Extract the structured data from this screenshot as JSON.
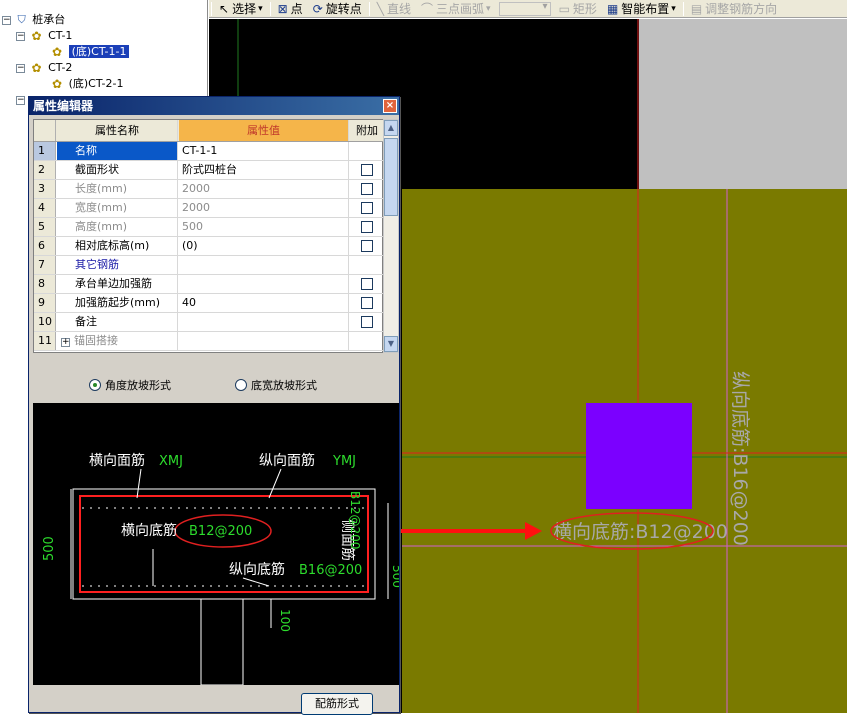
{
  "tree": {
    "root_label": "桩承台",
    "nodes": [
      {
        "label": "CT-1"
      },
      {
        "label": "(底)CT-1-1"
      },
      {
        "label": "CT-2"
      },
      {
        "label": "(底)CT-2-1"
      }
    ]
  },
  "toolbar": {
    "select_label": "选择",
    "point_label": "点",
    "rotate_point_label": "旋转点",
    "line_label": "直线",
    "arc_label": "三点画弧",
    "rect_label": "矩形",
    "smart_layout_label": "智能布置",
    "adjust_label": "调整钢筋方向"
  },
  "dialog": {
    "title": "属性编辑器",
    "close_glyph": "×",
    "headers": {
      "name": "属性名称",
      "value": "属性值",
      "extra": "附加"
    },
    "rows": [
      {
        "num": "1",
        "name": "名称",
        "value": "CT-1-1",
        "checkbox": false
      },
      {
        "num": "2",
        "name": "截面形状",
        "value": "阶式四桩台",
        "checkbox": true
      },
      {
        "num": "3",
        "name": "长度(mm)",
        "value": "2000",
        "checkbox": true
      },
      {
        "num": "4",
        "name": "宽度(mm)",
        "value": "2000",
        "checkbox": true
      },
      {
        "num": "5",
        "name": "高度(mm)",
        "value": "500",
        "checkbox": true
      },
      {
        "num": "6",
        "name": "相对底标高(m)",
        "value": "(0)",
        "checkbox": true
      },
      {
        "num": "7",
        "name": "其它钢筋",
        "value": "",
        "checkbox": false
      },
      {
        "num": "8",
        "name": "承台单边加强筋",
        "value": "",
        "checkbox": true
      },
      {
        "num": "9",
        "name": "加强筋起步(mm)",
        "value": "40",
        "checkbox": true
      },
      {
        "num": "10",
        "name": "备注",
        "value": "",
        "checkbox": true
      },
      {
        "num": "11",
        "name": "锚固搭接",
        "value": "",
        "checkbox": false
      }
    ],
    "radio_angle": "角度放坡形式",
    "radio_width": "底宽放坡形式",
    "rebar_button": "配筋形式"
  },
  "preview": {
    "top_x_label": "横向面筋",
    "top_x_code": "XMJ",
    "top_y_label": "纵向面筋",
    "top_y_code": "YMJ",
    "bottom_x_label": "横向底筋",
    "bottom_x_code": "B12@200",
    "side_label": "侧面筋",
    "side_code": "B12@200",
    "bottom_y_label": "纵向底筋",
    "bottom_y_code": "B16@200",
    "dim_height": "500",
    "dim_pile": "100",
    "dim_right": "500"
  },
  "canvas": {
    "bottom_x_text": "横向底筋:B12@200",
    "bottom_y_text": "纵向底筋:B16@200",
    "colors": {
      "slab": "#7a7a00",
      "pile": "#7b00ff",
      "bg": "#000000",
      "gray": "#c0c0c0"
    }
  }
}
